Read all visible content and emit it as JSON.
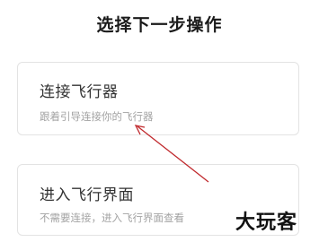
{
  "header": {
    "title": "选择下一步操作"
  },
  "options": [
    {
      "title": "连接飞行器",
      "description": "跟着引导连接你的飞行器"
    },
    {
      "title": "进入飞行界面",
      "description": "不需要连接，进入飞行界面查看"
    }
  ],
  "annotation": {
    "arrow_color": "#c0282c"
  },
  "watermark": {
    "text": "大玩客"
  }
}
